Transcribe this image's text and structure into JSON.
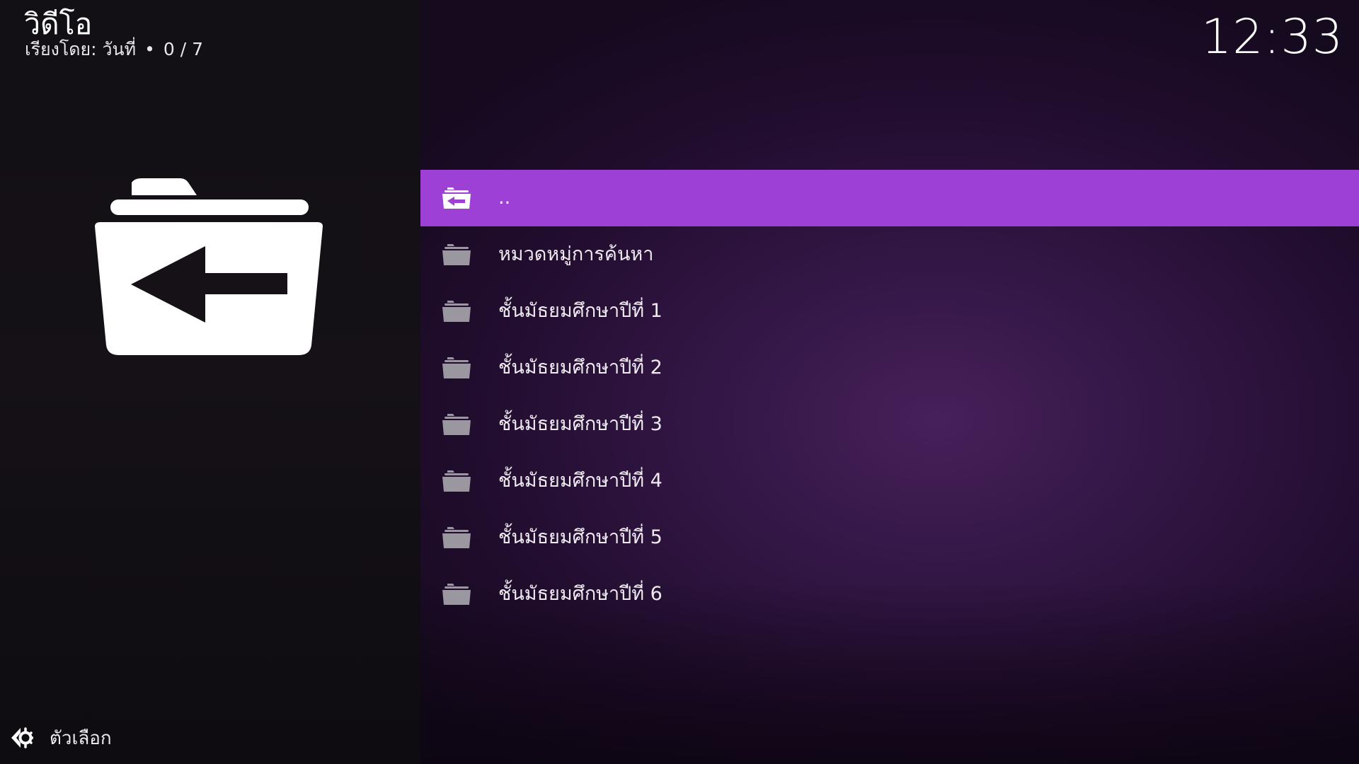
{
  "header": {
    "title": "วิดีโอ",
    "sort_label": "เรียงโดย: วันที่",
    "separator": "•",
    "position": "0 / 7"
  },
  "clock": "12:33",
  "colors": {
    "accent": "#9c40d6",
    "background_left": "#121014",
    "background_right": "#331645"
  },
  "artwork": {
    "icon": "folder-back-icon"
  },
  "list": {
    "items": [
      {
        "label": "..",
        "icon": "folder-back-icon",
        "focused": true
      },
      {
        "label": "หมวดหมู่การค้นหา",
        "icon": "folder-icon",
        "focused": false
      },
      {
        "label": "ชั้นมัธยมศึกษาปีที่ 1",
        "icon": "folder-icon",
        "focused": false
      },
      {
        "label": "ชั้นมัธยมศึกษาปีที่ 2",
        "icon": "folder-icon",
        "focused": false
      },
      {
        "label": "ชั้นมัธยมศึกษาปีที่ 3",
        "icon": "folder-icon",
        "focused": false
      },
      {
        "label": "ชั้นมัธยมศึกษาปีที่ 4",
        "icon": "folder-icon",
        "focused": false
      },
      {
        "label": "ชั้นมัธยมศึกษาปีที่ 5",
        "icon": "folder-icon",
        "focused": false
      },
      {
        "label": "ชั้นมัธยมศึกษาปีที่ 6",
        "icon": "folder-icon",
        "focused": false
      }
    ]
  },
  "footer": {
    "options_label": "ตัวเลือก",
    "options_icon": "options-gear-icon"
  }
}
